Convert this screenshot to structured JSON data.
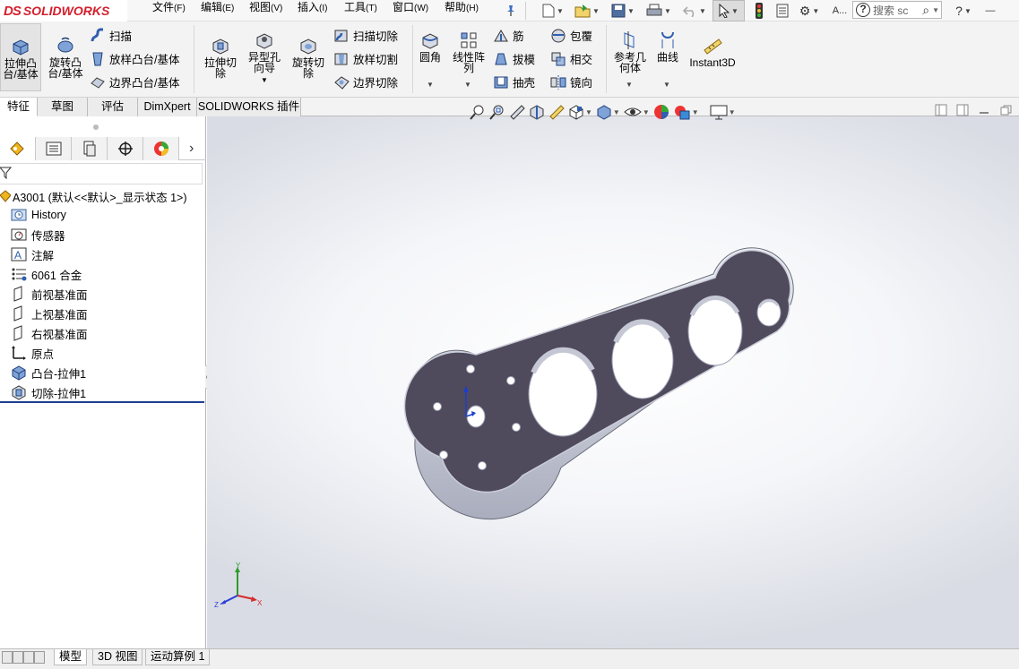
{
  "app": {
    "logo_prefix": "DS",
    "logo_text": "SOLIDWORKS"
  },
  "menus": [
    {
      "label": "文件",
      "key": "(F)"
    },
    {
      "label": "编辑",
      "key": "(E)"
    },
    {
      "label": "视图",
      "key": "(V)"
    },
    {
      "label": "插入",
      "key": "(I)"
    },
    {
      "label": "工具",
      "key": "(T)"
    },
    {
      "label": "窗口",
      "key": "(W)"
    },
    {
      "label": "帮助",
      "key": "(H)"
    }
  ],
  "search": {
    "placeholder": "搜索 sc",
    "partial_label": "A..."
  },
  "ribbon": {
    "extrude_boss": "拉伸凸台/基体",
    "revolve_boss": "旋转凸台/基体",
    "sweep": "扫描",
    "loft_boss": "放样凸台/基体",
    "boundary_boss": "边界凸台/基体",
    "extrude_cut": "拉伸切除",
    "hole_wizard": "异型孔向导",
    "revolve_cut": "旋转切除",
    "sweep_cut": "扫描切除",
    "loft_cut": "放样切割",
    "boundary_cut": "边界切除",
    "fillet": "圆角",
    "linear_pattern": "线性阵列",
    "rib": "筋",
    "draft": "拔模",
    "shell": "抽壳",
    "wrap": "包覆",
    "intersect": "相交",
    "mirror": "镜向",
    "ref_geometry": "参考几何体",
    "curves": "曲线",
    "instant3d": "Instant3D"
  },
  "tabs": [
    "特征",
    "草图",
    "评估",
    "DimXpert",
    "SOLIDWORKS 插件"
  ],
  "tree": {
    "root": "A3001  (默认<<默认>_显示状态 1>)",
    "items": [
      "History",
      "传感器",
      "注解",
      "6061 合金",
      "前视基准面",
      "上视基准面",
      "右视基准面",
      "原点",
      "凸台-拉伸1",
      "切除-拉伸1"
    ]
  },
  "triad": {
    "y": "Y",
    "z": "Z",
    "x": "X"
  },
  "bottom_tabs": [
    "模型",
    "3D 视图",
    "运动算例 1"
  ],
  "colors": {
    "brand_red": "#d31f2b",
    "part_face": "#4f4a5c",
    "part_edge": "#c9ccd8",
    "rollback_bar": "#1d3f8f"
  }
}
